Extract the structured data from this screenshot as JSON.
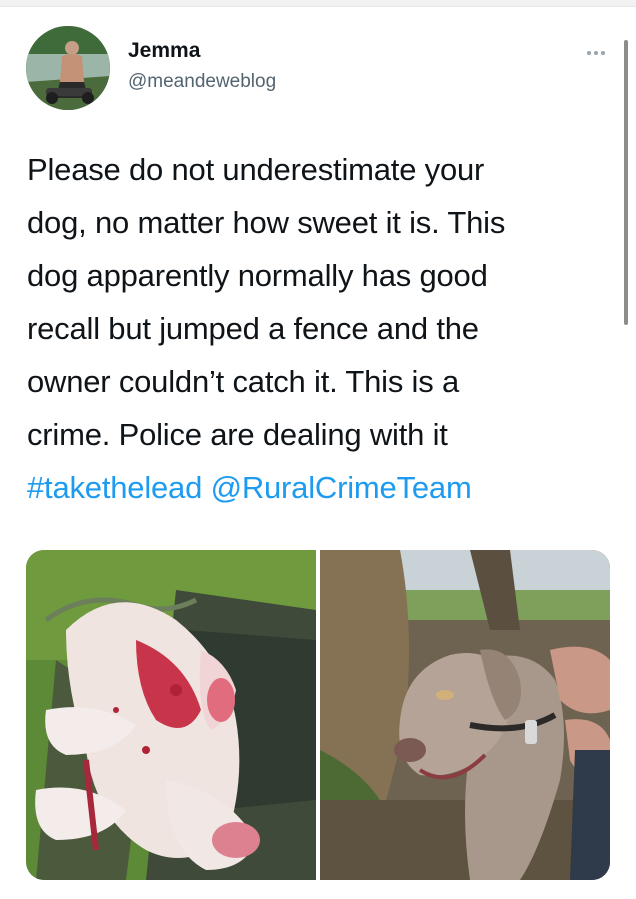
{
  "tweet": {
    "author": {
      "display_name": "Jemma",
      "handle": "@meandeweblog",
      "avatar_icon": "profile-photo"
    },
    "more_icon": "ellipsis-icon",
    "text_lines": [
      "Please do not underestimate your",
      "dog, no matter how sweet it is. This",
      "dog apparently normally has good",
      "recall but jumped a fence and the",
      "owner couldn’t catch it. This is a",
      "crime. Police are dealing with it"
    ],
    "hashtag": "#takethelead",
    "mention": "@RuralCrimeTeam",
    "link_color": "#1d9bf0",
    "media": [
      {
        "content": "injured-lamb-photo"
      },
      {
        "content": "weimaraner-dog-photo"
      }
    ]
  }
}
